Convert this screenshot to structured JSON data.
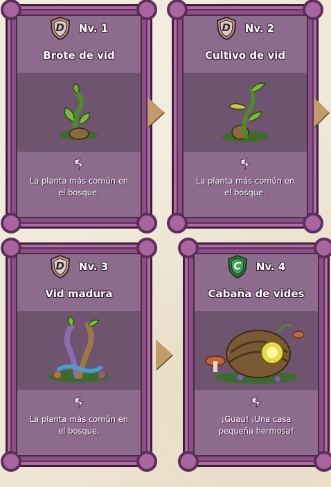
{
  "cards": [
    {
      "grade": "D",
      "level": "Nv. 1",
      "name": "Brote de vid",
      "desc_line1": "La planta más común en",
      "desc_line2": "el bosque.",
      "shield_color": "#d8cfc0"
    },
    {
      "grade": "D",
      "level": "Nv. 2",
      "name": "Cultivo de vid",
      "desc_line1": "La planta más común en",
      "desc_line2": "el bosque.",
      "shield_color": "#d8cfc0"
    },
    {
      "grade": "D",
      "level": "Nv. 3",
      "name": "Vid madura",
      "desc_line1": "La planta más común en",
      "desc_line2": "el bosque.",
      "shield_color": "#d8cfc0"
    },
    {
      "grade": "C",
      "level": "Nv. 4",
      "name": "Cabaña de vides",
      "desc_line1": "¡Guau! ¡Una casa",
      "desc_line2": "pequeña hermosa!",
      "shield_color": "#3fa35a"
    }
  ],
  "icons": {
    "shield": "grade-shield-icon",
    "leaf": "glyph-icon",
    "arrow": "next-arrow-icon"
  },
  "colors": {
    "card_frame": "#8a4f86",
    "card_inner": "#8c6b8c",
    "background": "#efe6d4",
    "arrow": "#c39a6a"
  }
}
